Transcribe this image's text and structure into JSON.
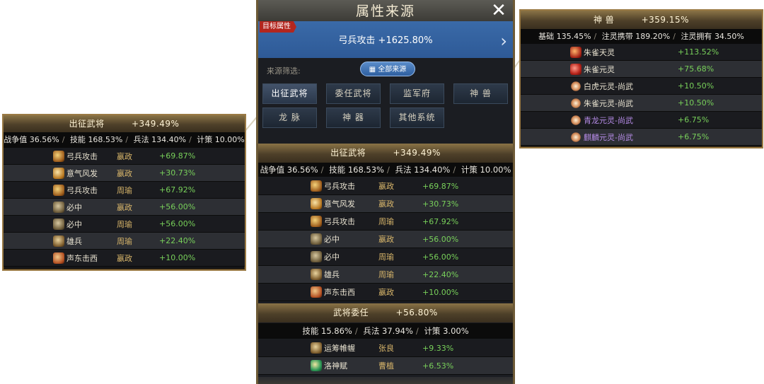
{
  "main": {
    "title": "属性来源",
    "close_icon": "close-icon",
    "target": {
      "tag": "目标属性",
      "value": "弓兵攻击  +1625.80%"
    },
    "filter": {
      "label": "来源筛选:",
      "all_button": "全部来源"
    },
    "categories": [
      "出征武将",
      "委任武将",
      "监军府",
      "神  兽",
      "龙  脉",
      "神  器",
      "其他系统"
    ],
    "section1": {
      "title": "出征武将",
      "total": "+349.49%",
      "breakdown": [
        {
          "k": "战争值",
          "v": "36.56%"
        },
        {
          "k": "技能",
          "v": "168.53%"
        },
        {
          "k": "兵法",
          "v": "134.40%"
        },
        {
          "k": "计策",
          "v": "10.00%"
        }
      ],
      "rows": [
        {
          "icon": "bow-skill-icon",
          "skill": "弓兵攻击",
          "hero": "嬴政",
          "value": "+69.87%"
        },
        {
          "icon": "spirit-skill-icon",
          "skill": "意气风发",
          "hero": "嬴政",
          "value": "+30.73%"
        },
        {
          "icon": "bow-skill-icon",
          "skill": "弓兵攻击",
          "hero": "周瑜",
          "value": "+67.92%"
        },
        {
          "icon": "hit-skill-icon",
          "skill": "必中",
          "hero": "嬴政",
          "value": "+56.00%"
        },
        {
          "icon": "hit-skill-icon",
          "skill": "必中",
          "hero": "周瑜",
          "value": "+56.00%"
        },
        {
          "icon": "troop-skill-icon",
          "skill": "雄兵",
          "hero": "周瑜",
          "value": "+22.40%"
        },
        {
          "icon": "feint-skill-icon",
          "skill": "声东击西",
          "hero": "嬴政",
          "value": "+10.00%"
        }
      ]
    },
    "section2": {
      "title": "武将委任",
      "total": "+56.80%",
      "breakdown": [
        {
          "k": "技能",
          "v": "15.86%"
        },
        {
          "k": "兵法",
          "v": "37.94%"
        },
        {
          "k": "计策",
          "v": "3.00%"
        }
      ],
      "rows": [
        {
          "icon": "strategy-skill-icon",
          "skill": "运筹帷幄",
          "hero": "张良",
          "value": "+9.33%"
        },
        {
          "icon": "goddess-skill-icon",
          "skill": "洛神赋",
          "hero": "曹植",
          "value": "+6.53%"
        }
      ]
    }
  },
  "left_panel": {
    "title": "出征武将",
    "total": "+349.49%",
    "breakdown": [
      {
        "k": "战争值",
        "v": "36.56%"
      },
      {
        "k": "技能",
        "v": "168.53%"
      },
      {
        "k": "兵法",
        "v": "134.40%"
      },
      {
        "k": "计策",
        "v": "10.00%"
      }
    ],
    "rows": [
      {
        "skill": "弓兵攻击",
        "hero": "嬴政",
        "value": "+69.87%"
      },
      {
        "skill": "意气风发",
        "hero": "嬴政",
        "value": "+30.73%"
      },
      {
        "skill": "弓兵攻击",
        "hero": "周瑜",
        "value": "+67.92%"
      },
      {
        "skill": "必中",
        "hero": "嬴政",
        "value": "+56.00%"
      },
      {
        "skill": "必中",
        "hero": "周瑜",
        "value": "+56.00%"
      },
      {
        "skill": "雄兵",
        "hero": "周瑜",
        "value": "+22.40%"
      },
      {
        "skill": "声东击西",
        "hero": "嬴政",
        "value": "+10.00%"
      }
    ]
  },
  "right_panel": {
    "title": "神  兽",
    "total": "+359.15%",
    "breakdown": [
      {
        "k": "基础",
        "v": "135.45%"
      },
      {
        "k": "注灵携带",
        "v": "189.20%"
      },
      {
        "k": "注灵拥有",
        "v": "34.50%"
      }
    ],
    "rows": [
      {
        "name": "朱雀天灵",
        "value": "+113.52%",
        "color": "#e8e2d0"
      },
      {
        "name": "朱雀元灵",
        "value": "+75.68%",
        "color": "#e8e2d0"
      },
      {
        "name": "白虎元灵-尚武",
        "value": "+10.50%",
        "color": "#e8e2d0"
      },
      {
        "name": "朱雀元灵-尚武",
        "value": "+10.50%",
        "color": "#e8e2d0"
      },
      {
        "name": "青龙元灵-尚武",
        "value": "+6.75%",
        "color": "#b58be6"
      },
      {
        "name": "麒麟元灵-尚武",
        "value": "+6.75%",
        "color": "#b58be6"
      }
    ]
  }
}
